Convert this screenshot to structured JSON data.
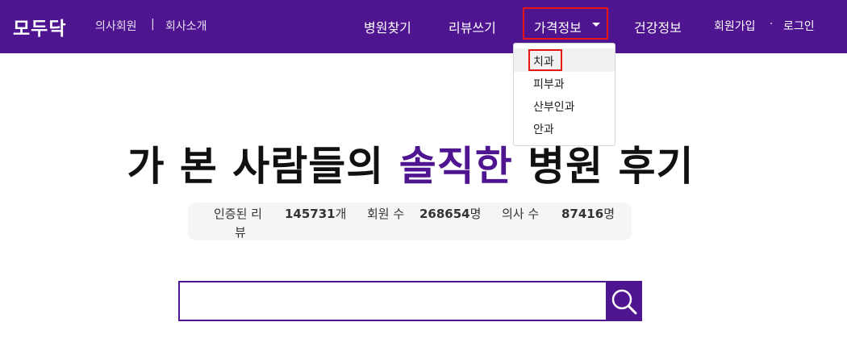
{
  "header": {
    "logo": "모두닥",
    "doctor_member": "의사회원",
    "separator": "|",
    "company_intro": "회사소개",
    "nav": {
      "find_hospital": "병원찾기",
      "write_review": "리뷰쓰기",
      "price_info": "가격정보",
      "health_info": "건강정보"
    },
    "signup": "회원가입",
    "dot": "·",
    "login": "로그인"
  },
  "price_dropdown": {
    "items": [
      "치과",
      "피부과",
      "산부인과",
      "안과"
    ]
  },
  "hero": {
    "part1": "가 본 사람들의",
    "accent": "솔직한",
    "part2": "병원 후기"
  },
  "stats": {
    "review_label_line1": "인증된 리",
    "review_label_line2": "뷰",
    "review_count": "145731",
    "review_unit": "개",
    "member_label": "회원 수",
    "member_count": "268654",
    "member_unit": "명",
    "doctor_label": "의사 수",
    "doctor_count": "87416",
    "doctor_unit": "명"
  },
  "search": {
    "placeholder": ""
  },
  "colors": {
    "brand": "#4f148f",
    "highlight_border": "#e81515"
  }
}
